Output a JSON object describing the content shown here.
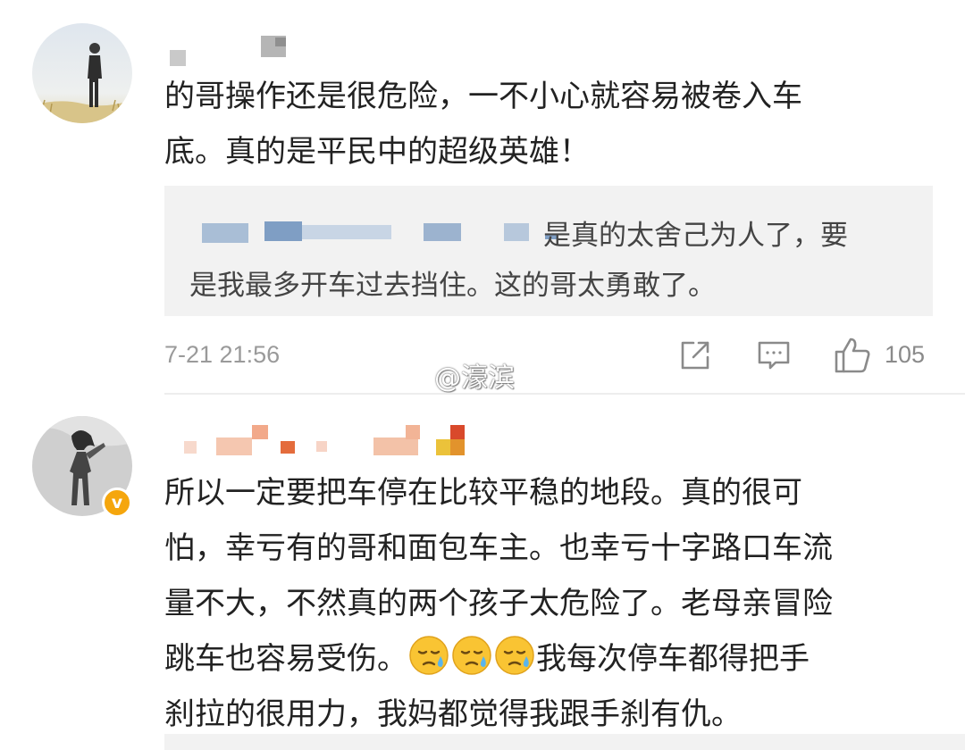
{
  "comments": [
    {
      "text_lines": [
        "的哥操作还是很危险，一不小心就容易被卷入车",
        "底。真的是平民中的超级英雄！"
      ],
      "quote": {
        "lines": [
          "是真的太舍己为人了，要",
          "是我最多开车过去挡住。这的哥太勇敢了。"
        ]
      },
      "timestamp": "7-21 21:56",
      "like_count": "105",
      "icons": [
        "share-icon",
        "comment-icon",
        "like-icon"
      ]
    },
    {
      "verified": true,
      "verified_badge": "v",
      "text_lines": [
        "所以一定要把车停在比较平稳的地段。真的很可",
        "怕，幸亏有的哥和面包车主。也幸亏十字路口车流",
        "量不大，不然真的两个孩子太危险了。老母亲冒险",
        "跳车也容易受伤。",
        "刹拉的很用力，我妈都觉得我跟手刹有仇。"
      ],
      "line4_after_emoji": "我每次停车都得把手",
      "emojis": [
        "sweat-face-emoji",
        "sweat-face-emoji",
        "sweat-face-emoji"
      ]
    }
  ],
  "watermark": "@濠滨",
  "colors": {
    "text": "#222222",
    "meta": "#9a9a9a",
    "quote_bg": "#f2f2f2",
    "verified_badge": "#f5a60d"
  }
}
